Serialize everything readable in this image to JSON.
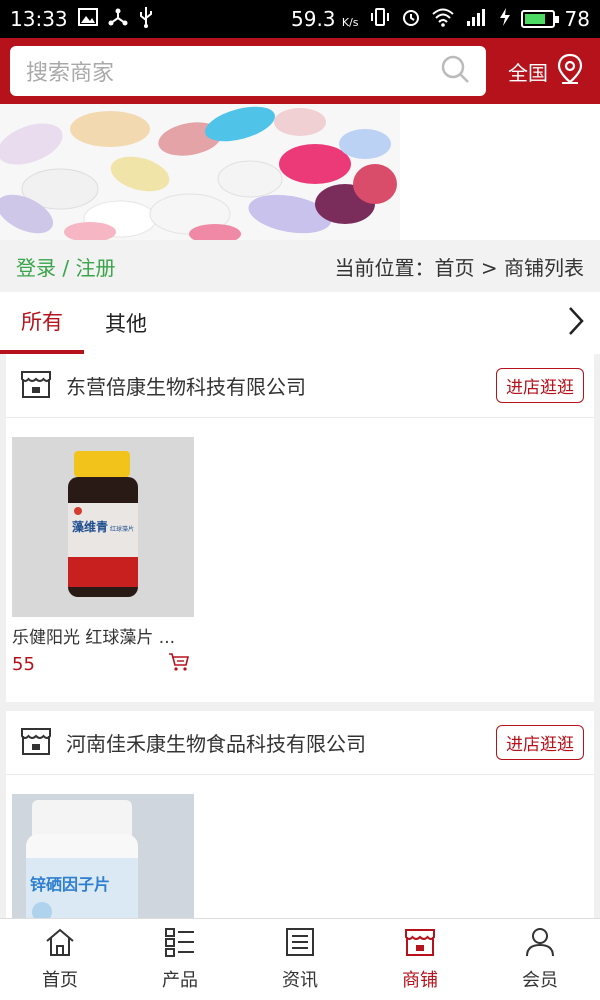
{
  "status_bar": {
    "time": "13:33",
    "speed": "59.3",
    "speed_unit": "K/s",
    "battery": "78",
    "battery_level": 0.78
  },
  "header": {
    "search_placeholder": "搜索商家",
    "region": "全国",
    "accent_color": "#b5121b"
  },
  "breadcrumb": {
    "login_register": "登录 / 注册",
    "location": "当前位置：首页 > 商铺列表"
  },
  "tabs": [
    {
      "label": "所有",
      "active": true
    },
    {
      "label": "其他",
      "active": false
    }
  ],
  "shops": [
    {
      "name": "东营倍康生物科技有限公司",
      "visit_label": "进店逛逛",
      "products": [
        {
          "name": "乐健阳光 红球藻片 ...",
          "price": "55",
          "label_main": "藻维青",
          "label_sub": "红球藻片"
        }
      ]
    },
    {
      "name": "河南佳禾康生物食品科技有限公司",
      "visit_label": "进店逛逛",
      "products": [
        {
          "name": "",
          "price": "",
          "label_main": "锌硒因子片",
          "label_sub": ""
        }
      ]
    }
  ],
  "bottom_nav": [
    {
      "label": "首页",
      "icon": "home-icon",
      "active": false
    },
    {
      "label": "产品",
      "icon": "list-icon",
      "active": false
    },
    {
      "label": "资讯",
      "icon": "news-icon",
      "active": false
    },
    {
      "label": "商铺",
      "icon": "store-icon",
      "active": true
    },
    {
      "label": "会员",
      "icon": "user-icon",
      "active": false
    }
  ]
}
